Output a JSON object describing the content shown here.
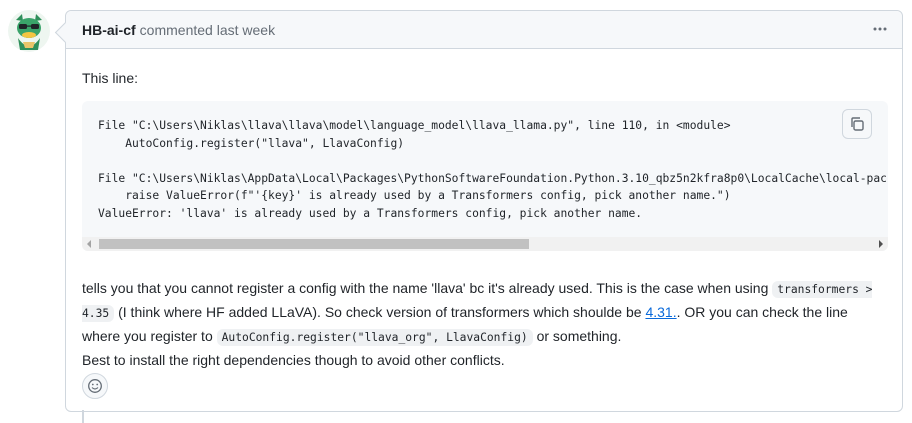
{
  "comment": {
    "author": "HB-ai-cf",
    "meta": "commented last week",
    "menu_icon": "kebab-horizontal-icon",
    "avatar_icon": "dragon-avatar",
    "intro": "This line:",
    "code_lines": [
      "File \"C:\\Users\\Niklas\\llava\\llava\\model\\language_model\\llava_llama.py\", line 110, in <module>",
      "    AutoConfig.register(\"llava\", LlavaConfig)",
      "",
      "File \"C:\\Users\\Niklas\\AppData\\Local\\Packages\\PythonSoftwareFoundation.Python.3.10_qbz5n2kfra8p0\\LocalCache\\local-packages",
      "    raise ValueError(f\"'{key}' is already used by a Transformers config, pick another name.\")",
      "ValueError: 'llava' is already used by a Transformers config, pick another name."
    ],
    "copy_icon": "copy-icon",
    "paragraph": {
      "part1": "tells you that you cannot register a config with the name 'llava' bc it's already used. This is the case when using ",
      "code1": "transformers > 4.35",
      "part2": " (I think where HF added LLaVA). So check version of transformers which shoulde be ",
      "link": "4.31.",
      "part3": ". OR you can check the line where you register to ",
      "code2": "AutoConfig.register(\"llava_org\", LlavaConfig)",
      "part4": " or something.",
      "line2": "Best to install the right dependencies though to avoid other conflicts."
    },
    "reaction_icon": "smiley-icon"
  }
}
